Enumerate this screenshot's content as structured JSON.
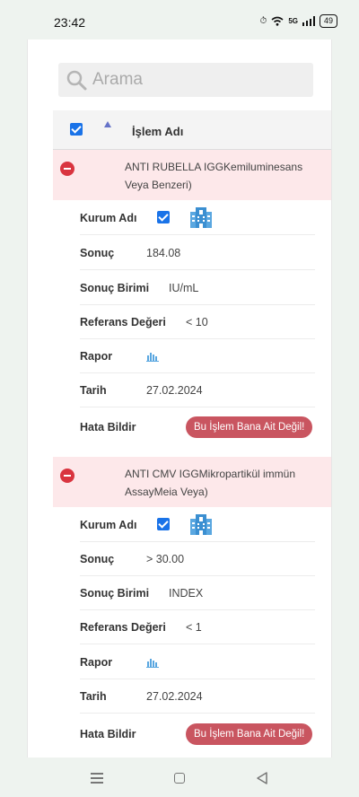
{
  "status_bar": {
    "time": "23:42",
    "network": "5G",
    "battery": "49"
  },
  "search": {
    "placeholder": "Arama"
  },
  "table": {
    "column_title": "İşlem Adı"
  },
  "records": [
    {
      "name_line1": "ANTI RUBELLA IGGKemiluminesans",
      "name_line2": "Veya Benzeri)",
      "fields": {
        "institution_label": "Kurum Adı",
        "result_label": "Sonuç",
        "result_value": "184.08",
        "unit_label": "Sonuç Birimi",
        "unit_value": "IU/mL",
        "reference_label": "Referans Değeri",
        "reference_value": "< 10",
        "report_label": "Rapor",
        "date_label": "Tarih",
        "date_value": "27.02.2024",
        "error_label": "Hata Bildir",
        "error_button": "Bu İşlem Bana Ait Değil!"
      }
    },
    {
      "name_line1": "ANTI CMV IGGMikropartikül immün",
      "name_line2": "AssayMeia Veya)",
      "fields": {
        "institution_label": "Kurum Adı",
        "result_label": "Sonuç",
        "result_value": "> 30.00",
        "unit_label": "Sonuç Birimi",
        "unit_value": "INDEX",
        "reference_label": "Referans Değeri",
        "reference_value": "< 1",
        "report_label": "Rapor",
        "date_label": "Tarih",
        "date_value": "27.02.2024",
        "error_label": "Hata Bildir",
        "error_button": "Bu İşlem Bana Ait Değil!"
      }
    }
  ],
  "colors": {
    "accent": "#1a73e8",
    "danger": "#d9343f",
    "row_highlight": "#fde8ea",
    "button": "#c95560"
  },
  "icons": [
    "search-icon",
    "sort-asc-icon",
    "collapse-icon",
    "hospital-building-icon",
    "bar-chart-icon",
    "menu-icon",
    "home-icon",
    "back-icon"
  ]
}
